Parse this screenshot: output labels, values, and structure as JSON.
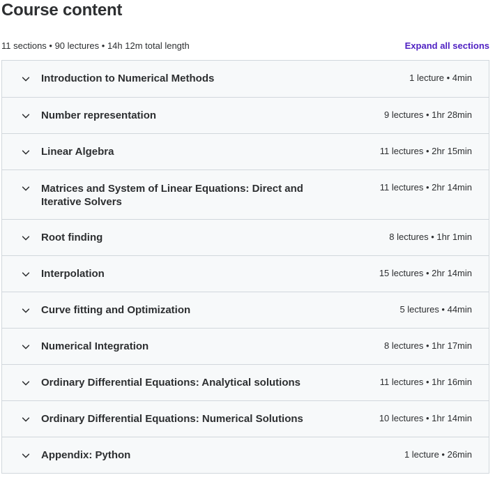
{
  "header": {
    "title": "Course content",
    "summary": "11 sections • 90 lectures • 14h 12m total length",
    "expand_label": "Expand all sections"
  },
  "sections": [
    {
      "title": "Introduction to Numerical Methods",
      "meta": "1 lecture • 4min"
    },
    {
      "title": "Number representation",
      "meta": "9 lectures • 1hr 28min"
    },
    {
      "title": "Linear Algebra",
      "meta": "11 lectures • 2hr 15min"
    },
    {
      "title": "Matrices and System of Linear Equations: Direct and Iterative Solvers",
      "meta": "11 lectures • 2hr 14min"
    },
    {
      "title": "Root finding",
      "meta": "8 lectures • 1hr 1min"
    },
    {
      "title": "Interpolation",
      "meta": "15 lectures • 2hr 14min"
    },
    {
      "title": "Curve fitting and Optimization",
      "meta": "5 lectures • 44min"
    },
    {
      "title": "Numerical Integration",
      "meta": "8 lectures • 1hr 17min"
    },
    {
      "title": "Ordinary Differential Equations: Analytical solutions",
      "meta": "11 lectures • 1hr 16min"
    },
    {
      "title": "Ordinary Differential Equations: Numerical Solutions",
      "meta": "10 lectures • 1hr 14min"
    },
    {
      "title": "Appendix: Python",
      "meta": "1 lecture • 26min"
    }
  ],
  "colors": {
    "accent": "#5022c3",
    "section_bg": "#f7f9fa",
    "border": "#d1d7dc",
    "text": "#2d2f31"
  },
  "icons": {
    "section_toggle": "chevron-down-icon"
  }
}
